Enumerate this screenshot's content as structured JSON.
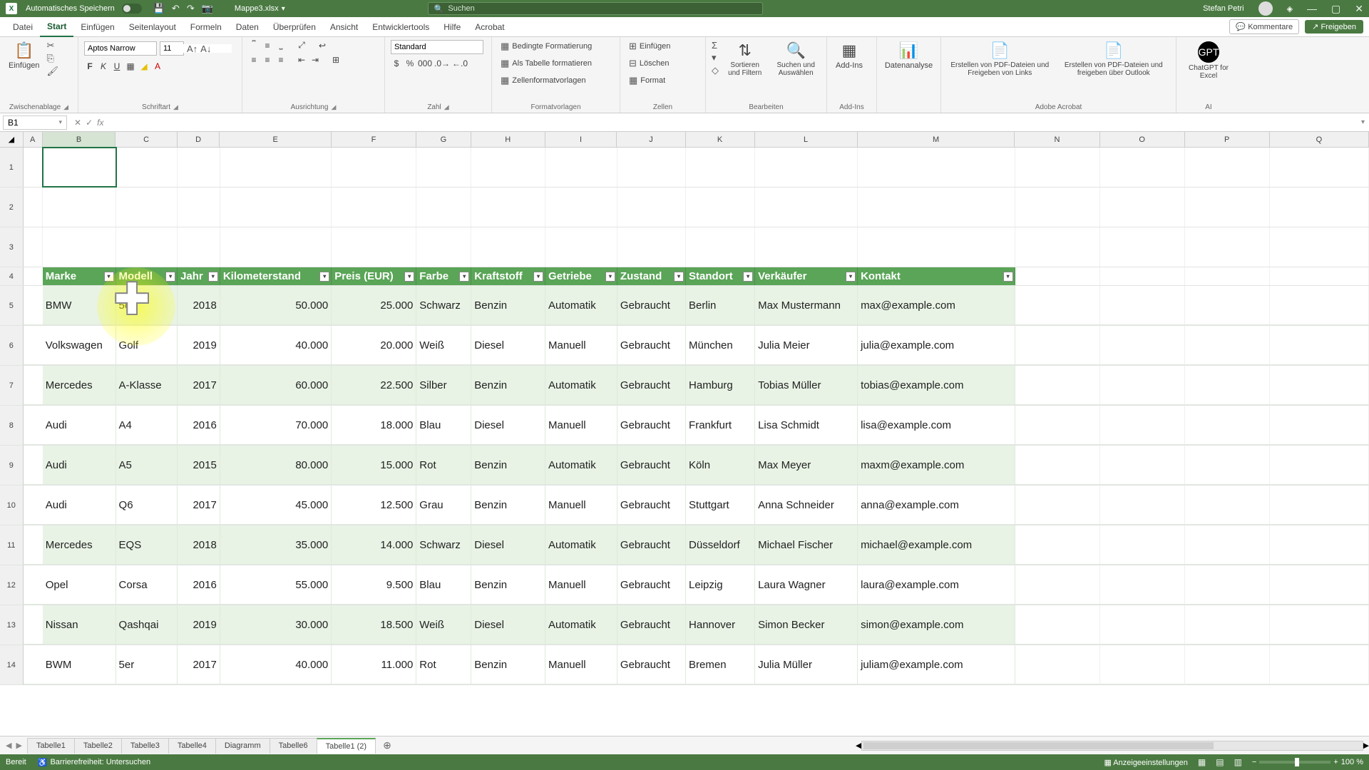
{
  "titlebar": {
    "autosave_label": "Automatisches Speichern",
    "doc_title": "Mappe3.xlsx",
    "search_placeholder": "Suchen",
    "user_name": "Stefan Petri"
  },
  "tabs": {
    "items": [
      "Datei",
      "Start",
      "Einfügen",
      "Seitenlayout",
      "Formeln",
      "Daten",
      "Überprüfen",
      "Ansicht",
      "Entwicklertools",
      "Hilfe",
      "Acrobat"
    ],
    "active_index": 1,
    "comments": "Kommentare",
    "share": "Freigeben"
  },
  "ribbon": {
    "clipboard": {
      "paste": "Einfügen",
      "group": "Zwischenablage"
    },
    "font": {
      "name": "Aptos Narrow",
      "size": "11",
      "group": "Schriftart"
    },
    "align": {
      "group": "Ausrichtung"
    },
    "number": {
      "format": "Standard",
      "group": "Zahl"
    },
    "styles": {
      "cond": "Bedingte Formatierung",
      "astable": "Als Tabelle formatieren",
      "cellstyles": "Zellenformatvorlagen",
      "group": "Formatvorlagen"
    },
    "cells": {
      "insert": "Einfügen",
      "delete": "Löschen",
      "format": "Format",
      "group": "Zellen"
    },
    "editing": {
      "sort": "Sortieren und Filtern",
      "find": "Suchen und Auswählen",
      "group": "Bearbeiten"
    },
    "addins": {
      "btn": "Add-Ins",
      "group": "Add-Ins"
    },
    "analysis": {
      "btn": "Datenanalyse"
    },
    "acrobat": {
      "pdf1": "Erstellen von PDF-Dateien und Freigeben von Links",
      "pdf2": "Erstellen von PDF-Dateien und freigeben über Outlook",
      "group": "Adobe Acrobat"
    },
    "ai": {
      "btn": "ChatGPT for Excel",
      "group": "AI"
    }
  },
  "formula_bar": {
    "name_box": "B1",
    "formula": ""
  },
  "columns": [
    "A",
    "B",
    "C",
    "D",
    "E",
    "F",
    "G",
    "H",
    "I",
    "J",
    "K",
    "L",
    "M",
    "N",
    "O",
    "P",
    "Q"
  ],
  "row_headers": [
    "1",
    "2",
    "3",
    "4",
    "5",
    "6",
    "7",
    "8",
    "9",
    "10",
    "11",
    "12",
    "13",
    "14"
  ],
  "table": {
    "headers": [
      "Marke",
      "Modell",
      "Jahr",
      "Kilometerstand",
      "Preis (EUR)",
      "Farbe",
      "Kraftstoff",
      "Getriebe",
      "Zustand",
      "Standort",
      "Verkäufer",
      "Kontakt"
    ],
    "rows": [
      [
        "BMW",
        "5er",
        "2018",
        "50.000",
        "25.000",
        "Schwarz",
        "Benzin",
        "Automatik",
        "Gebraucht",
        "Berlin",
        "Max Mustermann",
        "max@example.com"
      ],
      [
        "Volkswagen",
        "Golf",
        "2019",
        "40.000",
        "20.000",
        "Weiß",
        "Diesel",
        "Manuell",
        "Gebraucht",
        "München",
        "Julia Meier",
        "julia@example.com"
      ],
      [
        "Mercedes",
        "A-Klasse",
        "2017",
        "60.000",
        "22.500",
        "Silber",
        "Benzin",
        "Automatik",
        "Gebraucht",
        "Hamburg",
        "Tobias Müller",
        "tobias@example.com"
      ],
      [
        "Audi",
        "A4",
        "2016",
        "70.000",
        "18.000",
        "Blau",
        "Diesel",
        "Manuell",
        "Gebraucht",
        "Frankfurt",
        "Lisa Schmidt",
        "lisa@example.com"
      ],
      [
        "Audi",
        "A5",
        "2015",
        "80.000",
        "15.000",
        "Rot",
        "Benzin",
        "Automatik",
        "Gebraucht",
        "Köln",
        "Max Meyer",
        "maxm@example.com"
      ],
      [
        "Audi",
        "Q6",
        "2017",
        "45.000",
        "12.500",
        "Grau",
        "Benzin",
        "Manuell",
        "Gebraucht",
        "Stuttgart",
        "Anna Schneider",
        "anna@example.com"
      ],
      [
        "Mercedes",
        "EQS",
        "2018",
        "35.000",
        "14.000",
        "Schwarz",
        "Diesel",
        "Automatik",
        "Gebraucht",
        "Düsseldorf",
        "Michael Fischer",
        "michael@example.com"
      ],
      [
        "Opel",
        "Corsa",
        "2016",
        "55.000",
        "9.500",
        "Blau",
        "Benzin",
        "Manuell",
        "Gebraucht",
        "Leipzig",
        "Laura Wagner",
        "laura@example.com"
      ],
      [
        "Nissan",
        "Qashqai",
        "2019",
        "30.000",
        "18.500",
        "Weiß",
        "Diesel",
        "Automatik",
        "Gebraucht",
        "Hannover",
        "Simon Becker",
        "simon@example.com"
      ],
      [
        "BWM",
        "5er",
        "2017",
        "40.000",
        "11.000",
        "Rot",
        "Benzin",
        "Manuell",
        "Gebraucht",
        "Bremen",
        "Julia Müller",
        "juliam@example.com"
      ]
    ]
  },
  "sheet_tabs": {
    "items": [
      "Tabelle1",
      "Tabelle2",
      "Tabelle3",
      "Tabelle4",
      "Diagramm",
      "Tabelle6",
      "Tabelle1 (2)"
    ],
    "active_index": 6
  },
  "statusbar": {
    "ready": "Bereit",
    "access": "Barrierefreiheit: Untersuchen",
    "display": "Anzeigeeinstellungen",
    "zoom": "100 %"
  }
}
